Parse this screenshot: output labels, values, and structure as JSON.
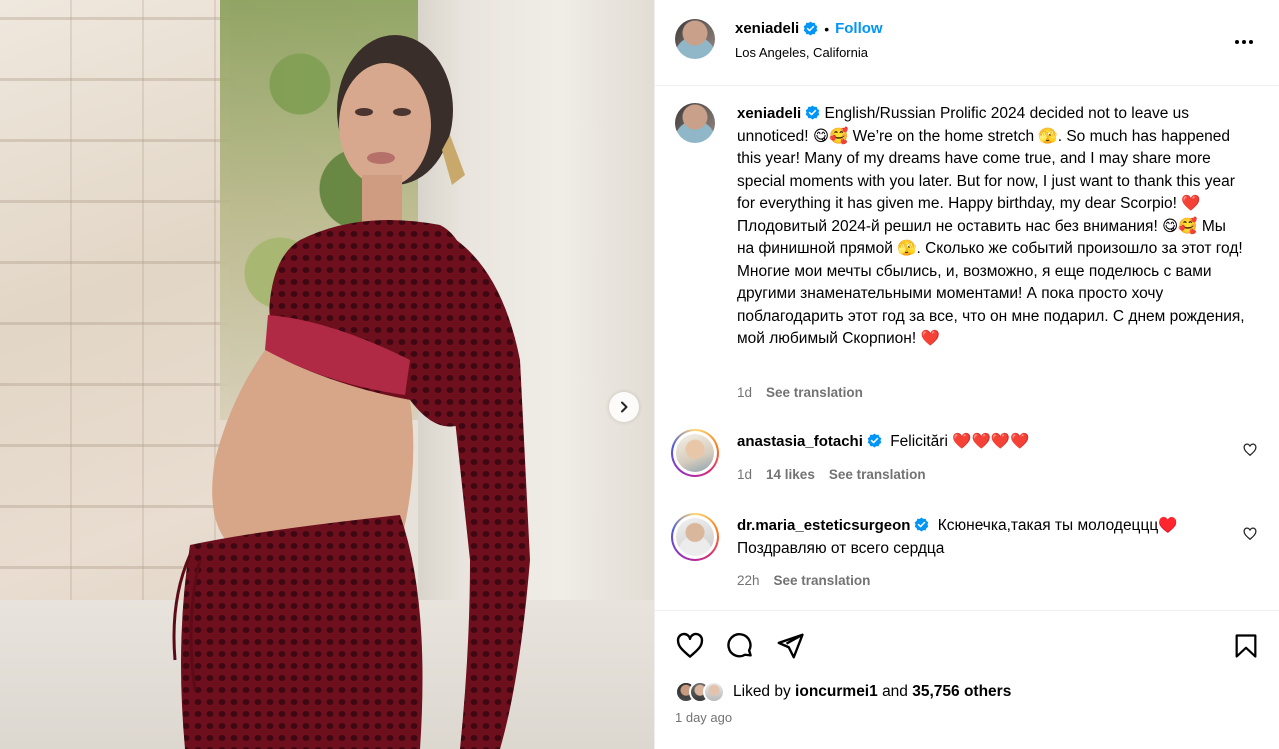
{
  "post": {
    "author": "xeniadeli",
    "follow_label": "Follow",
    "separator": "•",
    "location": "Los Angeles, California"
  },
  "caption": {
    "username": "xeniadeli",
    "text": "English/Russian Prolific 2024 decided not to leave us unnoticed! 😋🥰 We’re on the home stretch 🫣. So much has happened this year! Many of my dreams have come true, and I may share more special moments with you later. But for now, I just want to thank this year for everything it has given me. Happy birthday, my dear Scorpio! ❤️ Плодовитый 2024-й решил не оставить нас без внимания! 😋🥰 Мы на финишной прямой 🫣. Сколько же событий произошло за этот год! Многие мои мечты сбылись, и, возможно, я еще поделюсь с вами другими знаменательными моментами! А пока просто хочу поблагодарить этот год за все, что он мне подарил. С днем рождения, мой любимый Скорпион! ❤️",
    "time": "1d",
    "see_translation": "See translation"
  },
  "comments": [
    {
      "username": "anastasia_fotachi",
      "text": "Felicitări ❤️❤️❤️❤️",
      "time": "1d",
      "likes": "14 likes",
      "see_translation": "See translation"
    },
    {
      "username": "dr.maria_esteticsurgeon",
      "text": "Ксюнечка,такая ты молодеццц♥️ Поздравляю от всего сердца",
      "time": "22h",
      "see_translation": "See translation"
    }
  ],
  "engagement": {
    "liked_prefix": "Liked by",
    "liked_user": "ioncurmei1",
    "and_label": "and",
    "others": "35,756 others",
    "posted": "1 day ago"
  },
  "colors": {
    "accent": "#0095f6",
    "muted": "#737373",
    "heart": "#ed1c3a"
  },
  "icons": {
    "verified": "verified-badge-icon",
    "more": "more-options-icon",
    "like": "heart-icon",
    "comment": "comment-icon",
    "share": "send-icon",
    "save": "bookmark-icon",
    "next": "chevron-right-icon"
  }
}
